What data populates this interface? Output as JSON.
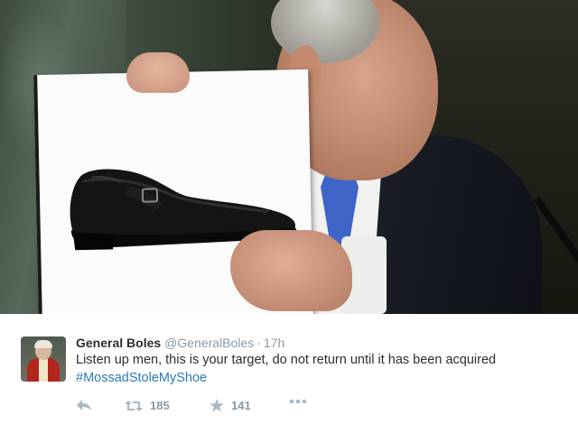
{
  "tweet": {
    "display_name": "General Boles",
    "handle": "@GeneralBoles",
    "separator": "·",
    "time": "17h",
    "text": "Listen up men, this is your target, do not return until it has been acquired",
    "hashtag": "#MossadStoleMyShoe",
    "retweets": "185",
    "favorites": "141"
  },
  "icons": {
    "reply": "reply-icon",
    "retweet": "retweet-icon",
    "favorite": "star-icon",
    "more": "more-icon"
  },
  "colors": {
    "name": "#292f33",
    "meta": "#8899a6",
    "link": "#2b7bb9",
    "icon": "#aab8c2"
  }
}
